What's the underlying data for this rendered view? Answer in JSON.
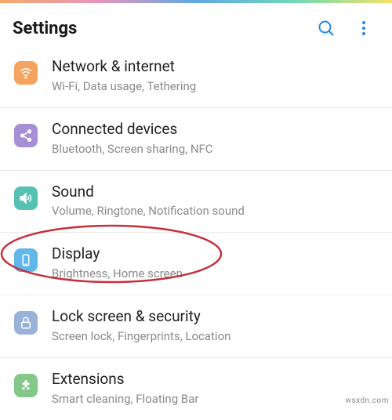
{
  "header": {
    "title": "Settings"
  },
  "items": [
    {
      "title": "Network & internet",
      "subtitle": "Wi-Fi, Data usage, Tethering",
      "icon": "wifi-icon",
      "color": "bg-orange"
    },
    {
      "title": "Connected devices",
      "subtitle": "Bluetooth, Screen sharing, NFC",
      "icon": "share-icon",
      "color": "bg-purple"
    },
    {
      "title": "Sound",
      "subtitle": "Volume, Ringtone, Notification sound",
      "icon": "sound-icon",
      "color": "bg-teal"
    },
    {
      "title": "Display",
      "subtitle": "Brightness, Home screen",
      "icon": "display-icon",
      "color": "bg-blue"
    },
    {
      "title": "Lock screen & security",
      "subtitle": "Screen lock, Fingerprints, Location",
      "icon": "lock-icon",
      "color": "bg-bluegray"
    },
    {
      "title": "Extensions",
      "subtitle": "Smart cleaning, Floating Bar",
      "icon": "extension-icon",
      "color": "bg-green"
    }
  ],
  "watermark": "wsxdn.com"
}
